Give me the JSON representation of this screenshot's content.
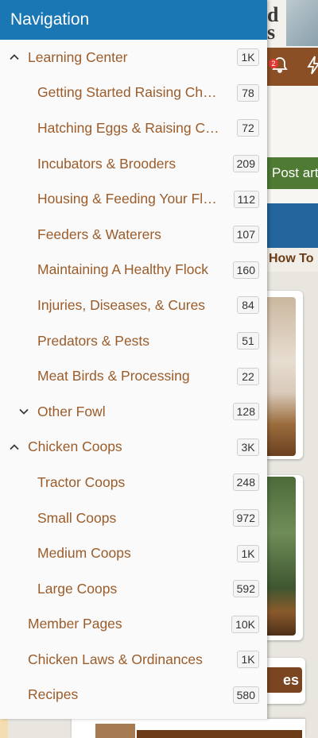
{
  "drawer": {
    "title": "Navigation",
    "items": [
      {
        "label": "Learning Center",
        "count": "1K",
        "level": 0,
        "chevron": "up"
      },
      {
        "label": "Getting Started Raising Chickens",
        "count": "78",
        "level": 1,
        "chevron": ""
      },
      {
        "label": "Hatching Eggs & Raising Chicks",
        "count": "72",
        "level": 1,
        "chevron": ""
      },
      {
        "label": "Incubators & Brooders",
        "count": "209",
        "level": 1,
        "chevron": ""
      },
      {
        "label": "Housing & Feeding Your Flock",
        "count": "112",
        "level": 1,
        "chevron": ""
      },
      {
        "label": "Feeders & Waterers",
        "count": "107",
        "level": 1,
        "chevron": ""
      },
      {
        "label": "Maintaining A Healthy Flock",
        "count": "160",
        "level": 1,
        "chevron": ""
      },
      {
        "label": "Injuries, Diseases, & Cures",
        "count": "84",
        "level": 1,
        "chevron": ""
      },
      {
        "label": "Predators & Pests",
        "count": "51",
        "level": 1,
        "chevron": ""
      },
      {
        "label": "Meat Birds & Processing",
        "count": "22",
        "level": 1,
        "chevron": ""
      },
      {
        "label": "Other Fowl",
        "count": "128",
        "level": 1,
        "chevron": "down"
      },
      {
        "label": "Chicken Coops",
        "count": "3K",
        "level": 0,
        "chevron": "up"
      },
      {
        "label": "Tractor Coops",
        "count": "248",
        "level": 1,
        "chevron": ""
      },
      {
        "label": "Small Coops",
        "count": "972",
        "level": 1,
        "chevron": ""
      },
      {
        "label": "Medium Coops",
        "count": "1K",
        "level": 1,
        "chevron": ""
      },
      {
        "label": "Large Coops",
        "count": "592",
        "level": 1,
        "chevron": ""
      },
      {
        "label": "Member Pages",
        "count": "10K",
        "level": 0,
        "chevron": ""
      },
      {
        "label": "Chicken Laws & Ordinances",
        "count": "1K",
        "level": 0,
        "chevron": ""
      },
      {
        "label": "Recipes",
        "count": "580",
        "level": 0,
        "chevron": ""
      }
    ]
  },
  "background": {
    "logo_text": "d\ns",
    "notification_count": "2",
    "post_button_label": "Post art",
    "section_heading": "How To",
    "button_suffix": "es"
  },
  "colors": {
    "header_bg": "#1a77b3",
    "link": "#9b5c2a",
    "brown_bar": "#8a4f25",
    "post_green": "#4e7a34",
    "blue_band": "#23659c"
  }
}
